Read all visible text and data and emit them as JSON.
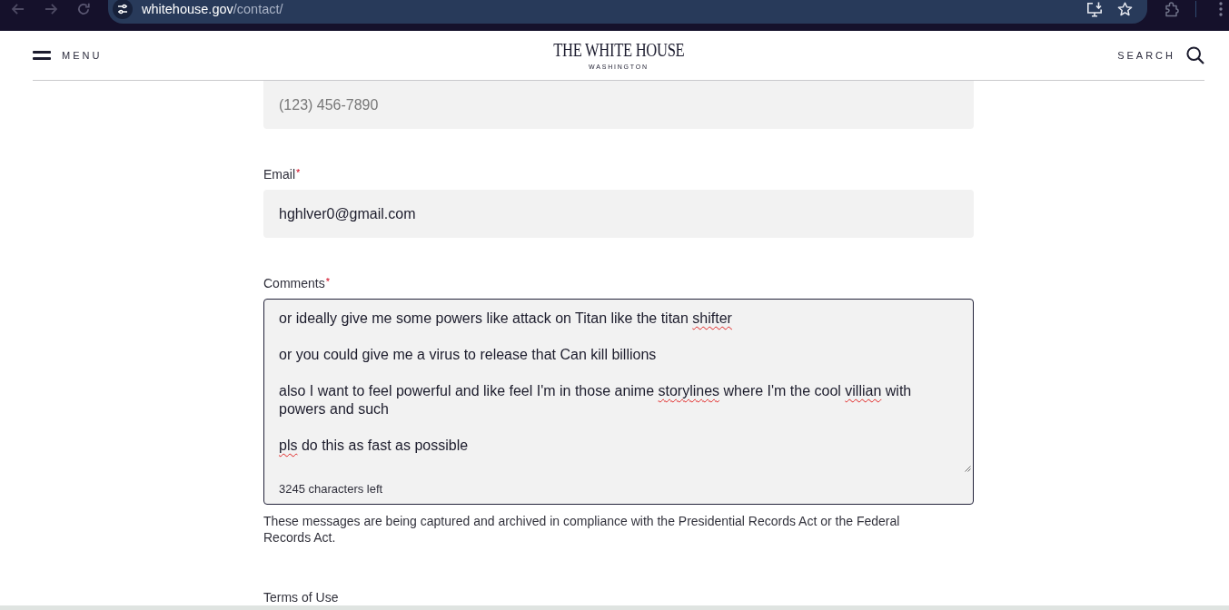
{
  "browser": {
    "address": {
      "host": "whitehouse.gov",
      "path": "/contact/"
    }
  },
  "header": {
    "menu_label": "MENU",
    "logo_title": "THE WHITE HOUSE",
    "logo_subtitle": "WASHINGTON",
    "search_label": "SEARCH"
  },
  "form": {
    "fields": [
      {
        "kind": "input",
        "placeholder": "(123) 456-7890"
      },
      {
        "kind": "input",
        "label": "Email",
        "required_mark": "*",
        "value": "hghlver0@gmail.com"
      },
      {
        "kind": "textarea",
        "label": "Comments",
        "required_mark": "*",
        "paragraphs": [
          {
            "segments": [
              {
                "text": "or ideally give me some powers like attack on Titan like the titan ",
                "misspelled": false
              },
              {
                "text": "shifter",
                "misspelled": true
              }
            ]
          },
          {
            "segments": [
              {
                "text": "or you could give me a virus to release that Can kill billions",
                "misspelled": false
              }
            ]
          },
          {
            "segments": [
              {
                "text": "also I want to feel powerful and like feel I'm in those anime ",
                "misspelled": false
              },
              {
                "text": "storylines",
                "misspelled": true
              },
              {
                "text": " where I'm the cool ",
                "misspelled": false
              },
              {
                "text": "villian",
                "misspelled": true
              },
              {
                "text": " with powers and such",
                "misspelled": false
              }
            ]
          },
          {
            "segments": [
              {
                "text": "pls",
                "misspelled": true
              },
              {
                "text": " do this as fast as possible",
                "misspelled": false
              }
            ]
          }
        ],
        "counter": "3245 characters left"
      }
    ],
    "notice": "These messages are being captured and archived in compliance with the Presidential Records Act or the Federal Records Act.",
    "terms_link": "Terms of Use"
  }
}
